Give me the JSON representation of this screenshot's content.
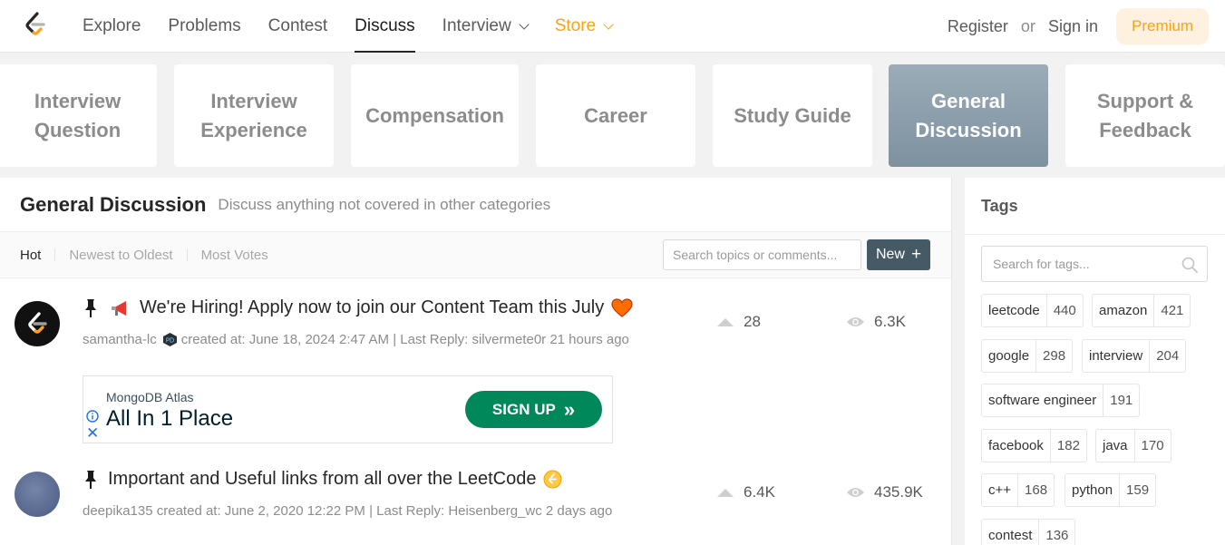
{
  "nav": {
    "links": [
      "Explore",
      "Problems",
      "Contest",
      "Discuss",
      "Interview",
      "Store"
    ],
    "active": "Discuss",
    "register": "Register",
    "or": "or",
    "signin": "Sign in",
    "premium": "Premium"
  },
  "categories": [
    {
      "line1": "Interview",
      "line2": "Question"
    },
    {
      "line1": "Interview",
      "line2": "Experience"
    },
    {
      "line1": "Compensation",
      "line2": ""
    },
    {
      "line1": "Career",
      "line2": ""
    },
    {
      "line1": "Study Guide",
      "line2": ""
    },
    {
      "line1": "General",
      "line2": "Discussion"
    },
    {
      "line1": "Support &",
      "line2": "Feedback"
    }
  ],
  "main": {
    "title": "General Discussion",
    "description": "Discuss anything not covered in other categories",
    "sort": {
      "hot": "Hot",
      "newest": "Newest to Oldest",
      "votes": "Most Votes"
    },
    "search_placeholder": "Search topics or comments...",
    "new_label": "New",
    "new_plus": "+"
  },
  "topics": [
    {
      "title": "We're Hiring! Apply now to join our Content Team this July",
      "author": "samantha-lc",
      "meta": "created at: June 18, 2024 2:47 AM | Last Reply: silvermete0r 21 hours ago",
      "votes": "28",
      "views": "6.3K"
    },
    {
      "title": "Important and Useful links from all over the LeetCode",
      "author": "deepika135",
      "meta": "created at: June 2, 2020 12:22 PM | Last Reply: Heisenberg_wc 2 days ago",
      "votes": "6.4K",
      "views": "435.9K"
    }
  ],
  "ad": {
    "brand": "MongoDB Atlas",
    "headline": "All In 1 Place",
    "button": "SIGN UP",
    "button_arrows": "»",
    "close": "✕"
  },
  "tags_panel": {
    "title": "Tags",
    "search_placeholder": "Search for tags...",
    "items": [
      {
        "name": "leetcode",
        "count": "440"
      },
      {
        "name": "amazon",
        "count": "421"
      },
      {
        "name": "google",
        "count": "298"
      },
      {
        "name": "interview",
        "count": "204"
      },
      {
        "name": "software engineer",
        "count": "191"
      },
      {
        "name": "facebook",
        "count": "182"
      },
      {
        "name": "java",
        "count": "170"
      },
      {
        "name": "c++",
        "count": "168"
      },
      {
        "name": "python",
        "count": "159"
      },
      {
        "name": "contest",
        "count": "136"
      }
    ]
  },
  "colors": {
    "accent": "#ffa116",
    "active_category": "#8a9ba8",
    "new_button": "#455a64",
    "ad_button": "#00875a"
  }
}
